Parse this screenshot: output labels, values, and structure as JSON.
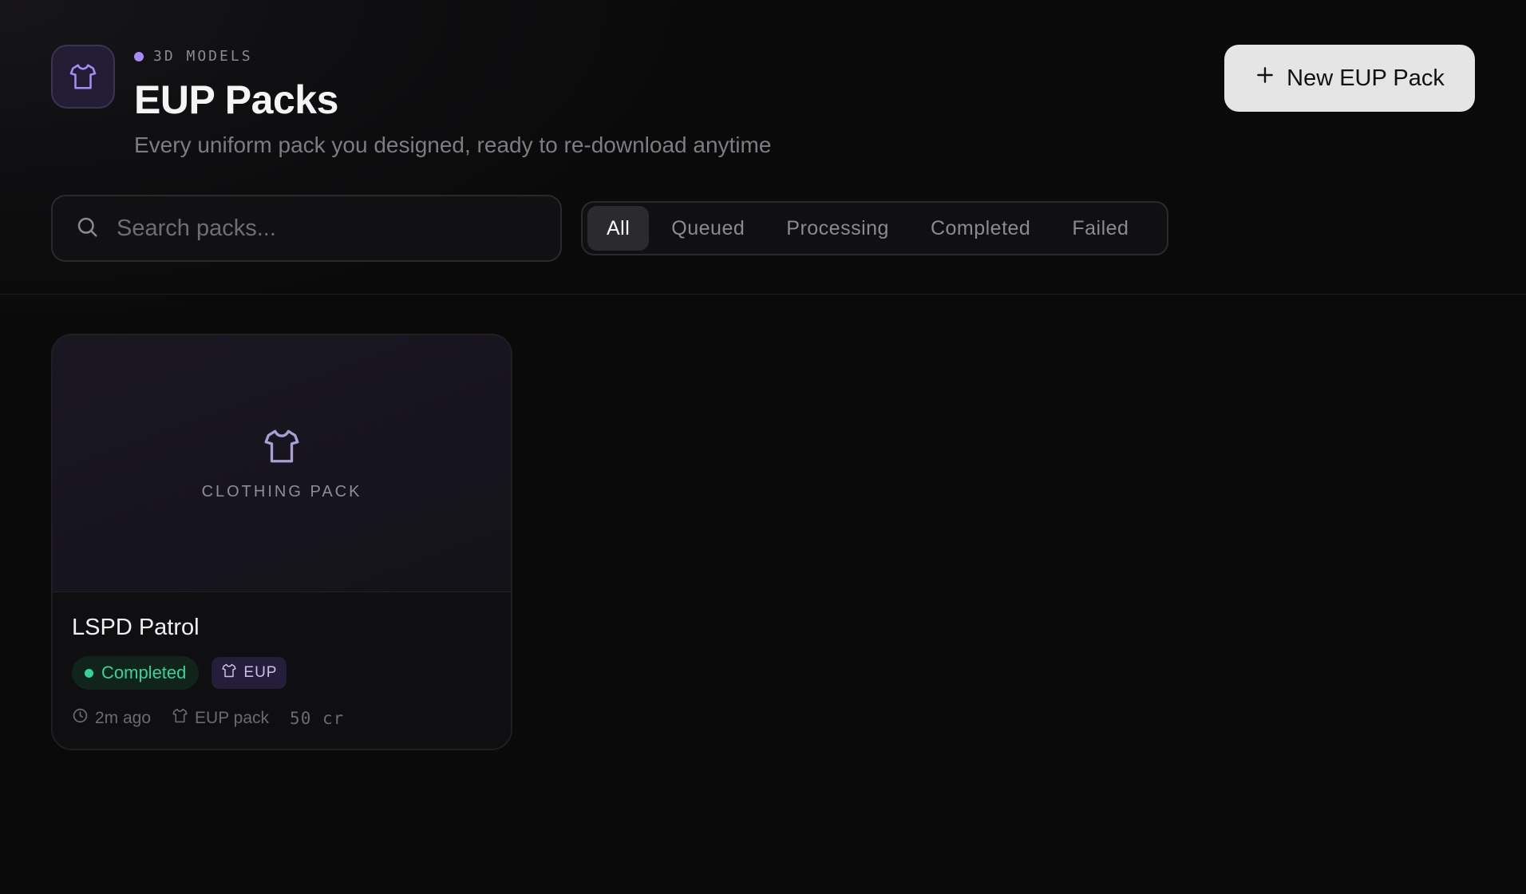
{
  "header": {
    "eyebrow": "3D MODELS",
    "title": "EUP Packs",
    "subtitle": "Every uniform pack you designed, ready to re-download anytime",
    "new_button_label": "New EUP Pack"
  },
  "search": {
    "placeholder": "Search packs...",
    "value": ""
  },
  "filters": {
    "tabs": [
      "All",
      "Queued",
      "Processing",
      "Completed",
      "Failed"
    ],
    "active": "All"
  },
  "packs": [
    {
      "thumb_label": "CLOTHING PACK",
      "name": "LSPD Patrol",
      "status": "Completed",
      "type": "EUP",
      "time": "2m ago",
      "kind": "EUP pack",
      "cost": "50 cr"
    }
  ],
  "colors": {
    "accent": "#a78bfa",
    "status_completed": "#34d399",
    "background": "#0a0a0a"
  },
  "icons": {
    "brand": "shirt-icon",
    "new": "plus-icon",
    "search": "search-icon",
    "time": "clock-icon",
    "kind": "shirt-icon"
  }
}
